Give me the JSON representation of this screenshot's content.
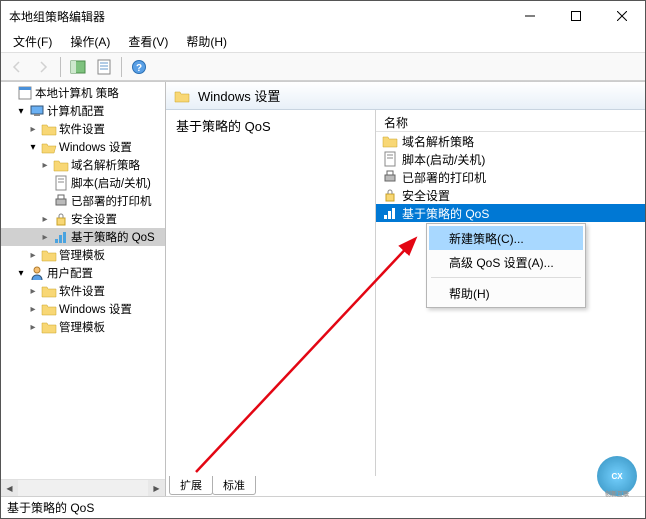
{
  "window": {
    "title": "本地组策略编辑器"
  },
  "menubar": {
    "file": "文件(F)",
    "action": "操作(A)",
    "view": "查看(V)",
    "help": "帮助(H)"
  },
  "tree": {
    "root": "本地计算机 策略",
    "computer_config": "计算机配置",
    "soft_settings_1": "软件设置",
    "windows_settings_1": "Windows 设置",
    "dns_policy_1": "域名解析策略",
    "scripts_1": "脚本(启动/关机)",
    "printers_1": "已部署的打印机",
    "security_1": "安全设置",
    "qos_1": "基于策略的 QoS",
    "admin_templates_1": "管理模板",
    "user_config": "用户配置",
    "soft_settings_2": "软件设置",
    "windows_settings_2": "Windows 设置",
    "admin_templates_2": "管理模板"
  },
  "breadcrumb": {
    "title": "Windows 设置"
  },
  "left_column": {
    "title": "基于策略的 QoS"
  },
  "list": {
    "header": "名称",
    "items": [
      {
        "label": "域名解析策略",
        "icon": "folder-icon"
      },
      {
        "label": "脚本(启动/关机)",
        "icon": "script-icon"
      },
      {
        "label": "已部署的打印机",
        "icon": "printer-icon"
      },
      {
        "label": "安全设置",
        "icon": "security-icon"
      },
      {
        "label": "基于策略的 QoS",
        "icon": "qos-icon"
      }
    ]
  },
  "context_menu": {
    "new_policy": "新建策略(C)...",
    "advanced": "高级 QoS 设置(A)...",
    "help": "帮助(H)"
  },
  "tabs": {
    "extended": "扩展",
    "standard": "标准"
  },
  "statusbar": {
    "text": "基于策略的 QoS"
  },
  "watermark_alt": "创新互联"
}
